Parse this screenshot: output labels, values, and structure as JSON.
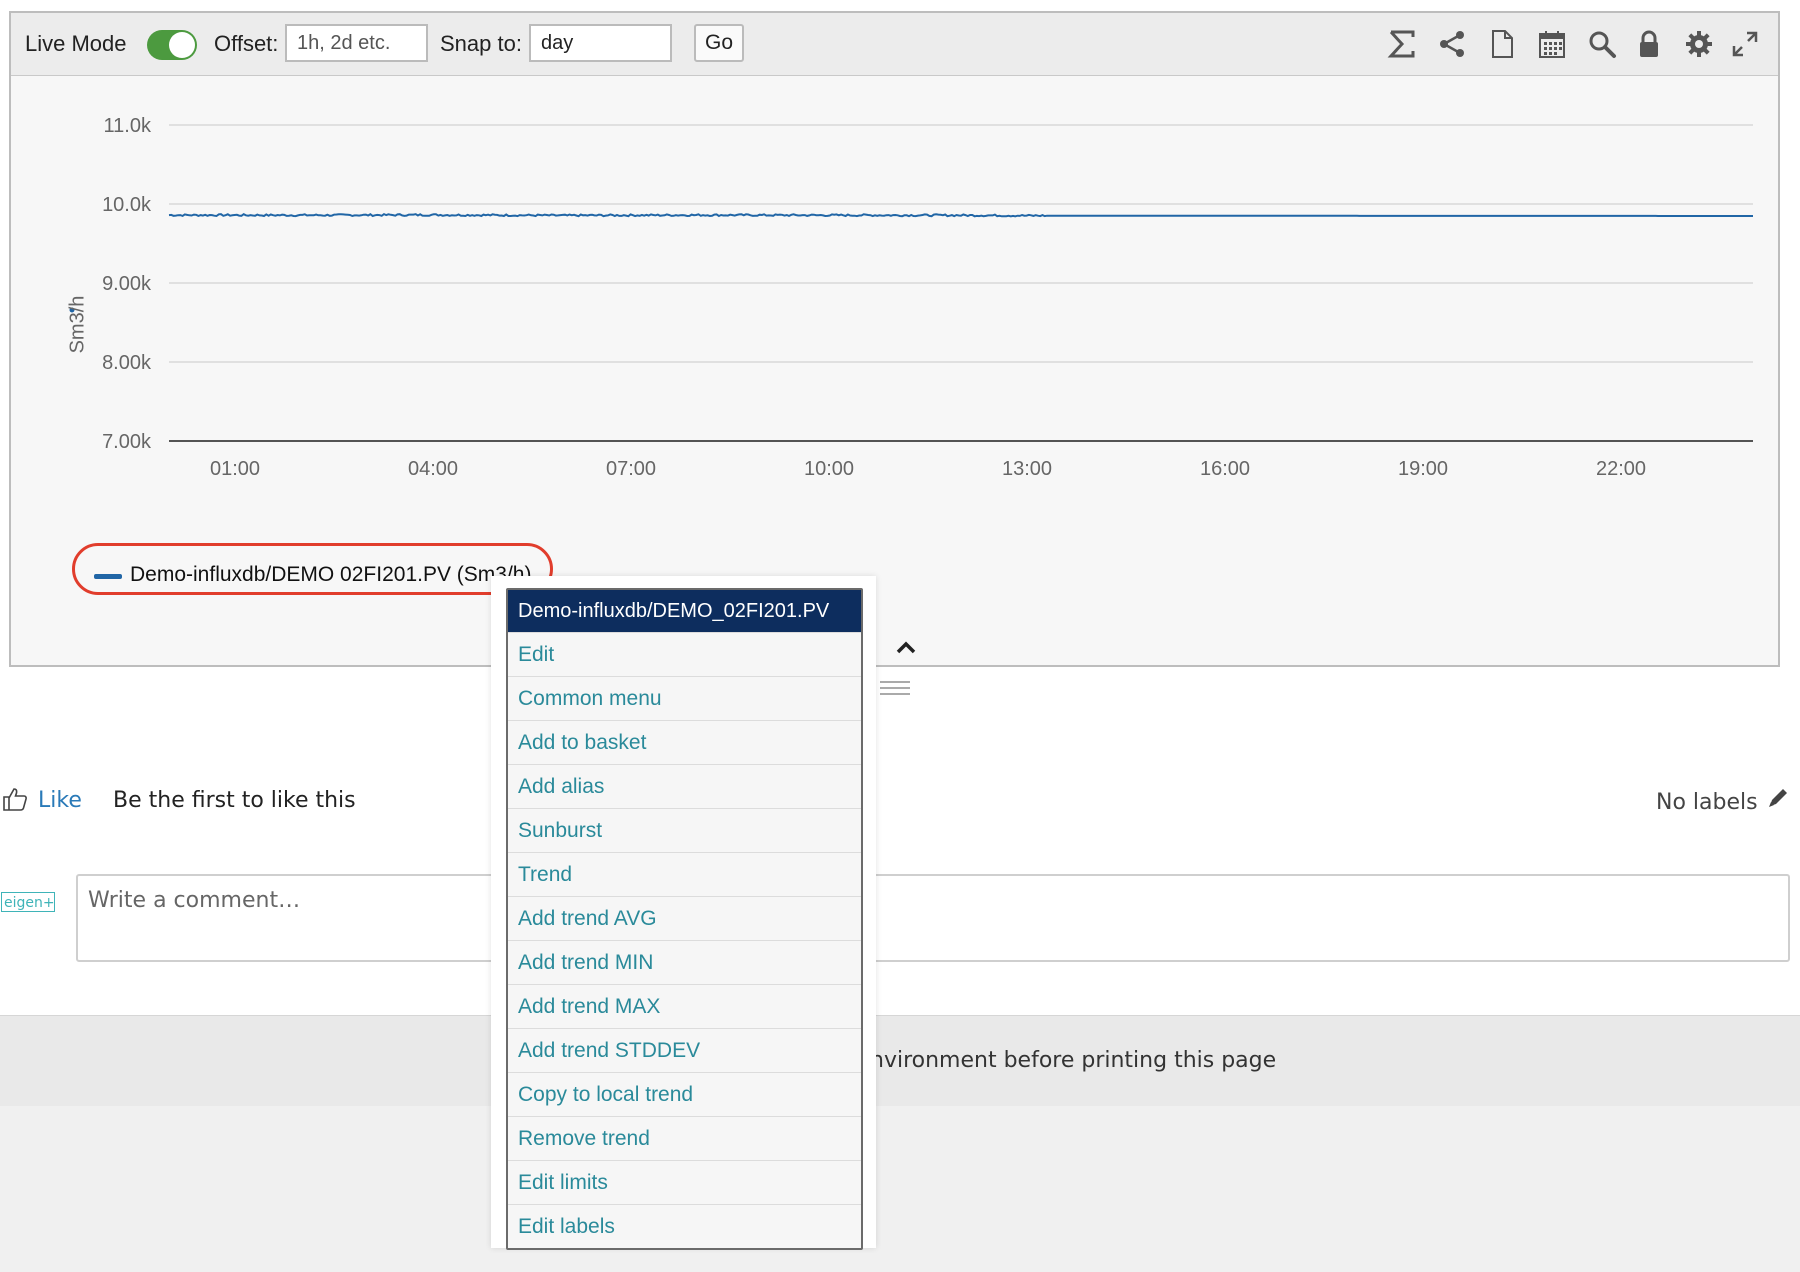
{
  "toolbar": {
    "live_mode_label": "Live Mode",
    "live_mode_on": true,
    "offset_label": "Offset:",
    "offset_placeholder": "1h, 2d etc.",
    "snap_label": "Snap to:",
    "snap_value": "day",
    "go_label": "Go",
    "icons": [
      "sigma-icon",
      "share-icon",
      "document-icon",
      "calendar-icon",
      "search-icon",
      "lock-icon",
      "gear-icon",
      "expand-icon"
    ]
  },
  "chart_data": {
    "type": "line",
    "ylabel": "Sm3/h",
    "y_ticks": [
      "11.0k",
      "10.0k",
      "9.00k",
      "8.00k",
      "7.00k"
    ],
    "ylim": [
      6500,
      11000
    ],
    "x_ticks": [
      "01:00",
      "04:00",
      "07:00",
      "10:00",
      "13:00",
      "16:00",
      "19:00",
      "22:00"
    ],
    "x_tick_hours": [
      1,
      4,
      7,
      10,
      13,
      16,
      19,
      22
    ],
    "xlim_hours": [
      0,
      24
    ],
    "grid": true,
    "series": [
      {
        "name": "Demo-influxdb/DEMO  02FI201.PV (Sm3/h)",
        "color": "#2166a6",
        "x_hours": [
          0,
          2,
          4,
          6,
          8,
          10,
          12,
          13.3,
          16,
          18,
          20,
          22,
          24
        ],
        "values": [
          9860,
          9858,
          9862,
          9855,
          9860,
          9858,
          9857,
          9852,
          9850,
          9850,
          9849,
          9849,
          9848
        ],
        "noise_until_hour": 13.3
      }
    ]
  },
  "legend": {
    "label": "Demo-influxdb/DEMO  02FI201.PV (Sm3/h)"
  },
  "context_menu": {
    "header": "Demo-influxdb/DEMO_02FI201.PV",
    "items": [
      "Edit",
      "Common menu",
      "Add to basket",
      "Add alias",
      "Sunburst",
      "Trend",
      "Add trend AVG",
      "Add trend MIN",
      "Add trend MAX",
      "Add trend STDDEV",
      "Copy to local trend",
      "Remove trend",
      "Edit limits",
      "Edit labels"
    ]
  },
  "social": {
    "like_label": "Like",
    "like_text": "Be the first to like this",
    "labels_text": "No labels"
  },
  "comment": {
    "avatar_text": "eigen+",
    "placeholder": "Write a comment…"
  },
  "footer": {
    "text": "nvironment before printing this page"
  }
}
